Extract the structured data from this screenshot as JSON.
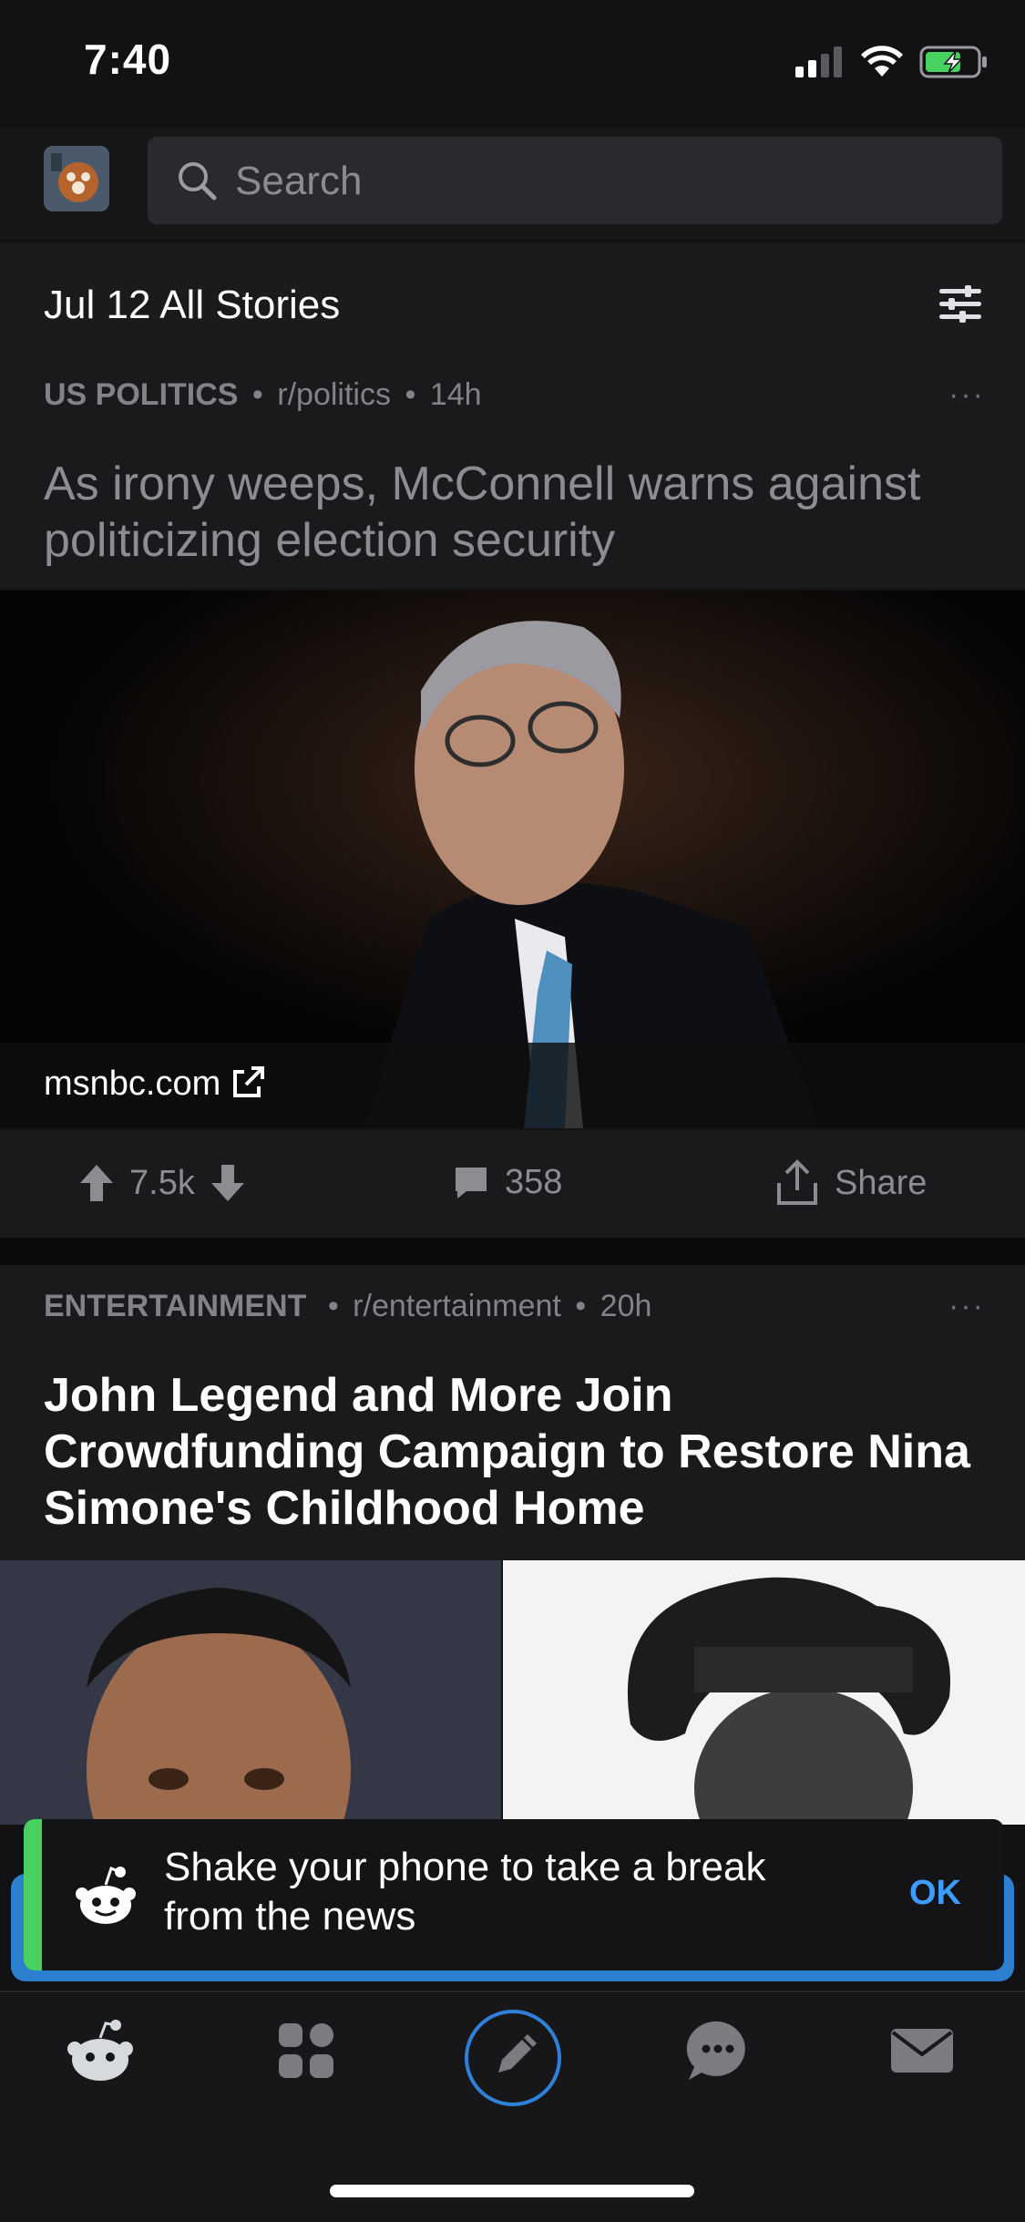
{
  "status_bar": {
    "time": "7:40"
  },
  "search": {
    "placeholder": "Search"
  },
  "feed_header": {
    "title": "Jul 12 All Stories"
  },
  "posts": [
    {
      "category": "US POLITICS",
      "subreddit": "r/politics",
      "age": "14h",
      "more": "···",
      "title": "As irony weeps, McConnell warns against politicizing election security",
      "source": "msnbc.com",
      "upvotes": "7.5k",
      "comments": "358",
      "share_label": "Share"
    },
    {
      "category": "ENTERTAINMENT",
      "subreddit": "r/entertainment",
      "age": "20h",
      "more": "···",
      "title": "John Legend and More Join Crowdfunding Campaign to Restore Nina Simone's Childhood Home"
    }
  ],
  "toast": {
    "message": "Shake your phone to take a break from the news",
    "ok_label": "OK"
  },
  "tab_bar": {
    "tabs": [
      "home-icon",
      "communities-icon",
      "post-icon",
      "chat-icon",
      "inbox-icon"
    ]
  },
  "colors": {
    "accent_blue": "#3c9cff",
    "toast_green": "#46d160",
    "background": "#121215"
  }
}
